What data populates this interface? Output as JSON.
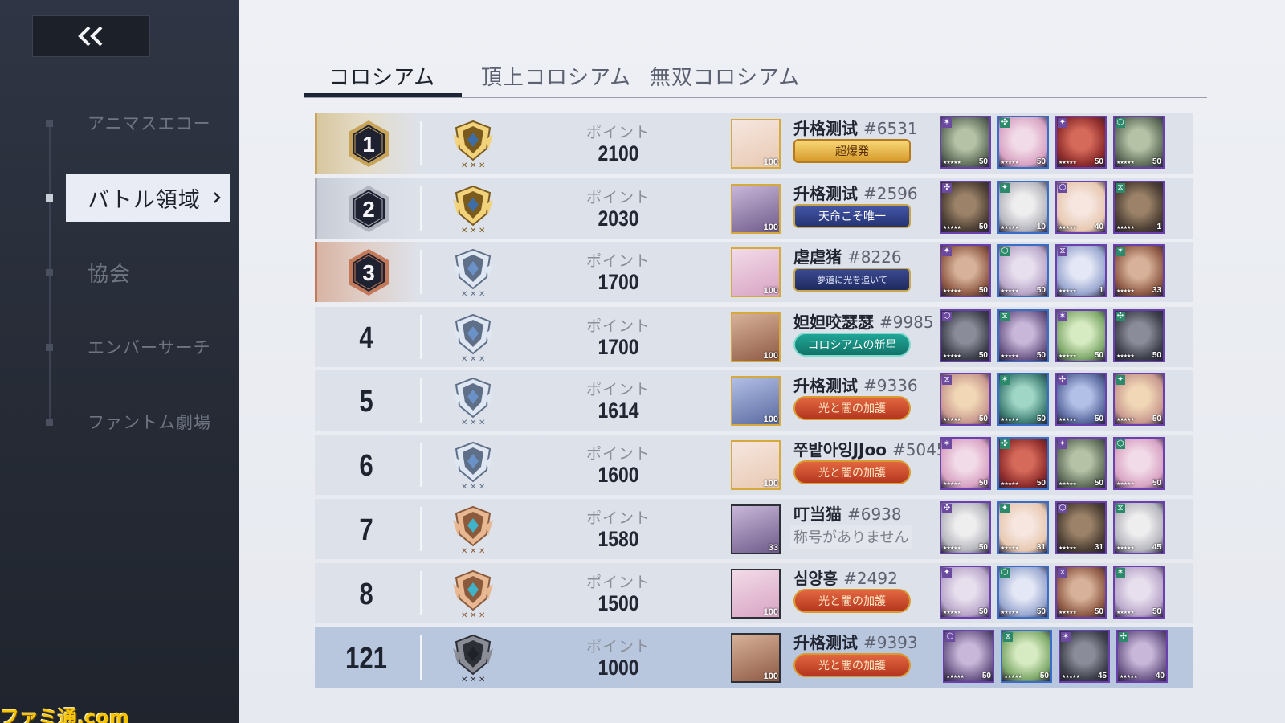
{
  "sidebar": {
    "back_icon": "double-chevron-left-icon",
    "items": [
      {
        "label": "アニマスエコー",
        "active": false
      },
      {
        "label": "バトル領域",
        "active": true
      },
      {
        "label": "協会",
        "active": false
      },
      {
        "label": "エンバーサーチ",
        "active": false
      },
      {
        "label": "ファントム劇場",
        "active": false
      }
    ],
    "watermark": "ファミ通.com"
  },
  "tabs": [
    {
      "label": "コロシアム",
      "active": true
    },
    {
      "label": "頂上コロシアム",
      "active": false
    },
    {
      "label": "無双コロシアム",
      "active": false
    }
  ],
  "ranking": {
    "points_label": "ポイント",
    "rows": [
      {
        "rank": "1",
        "tier": "gold",
        "points": "2100",
        "name": "升格测试",
        "tag": "#6531",
        "avatar_level": "100",
        "title": "超爆発",
        "title_style": "t-gold",
        "team": [
          {
            "level": "50"
          },
          {
            "level": "50"
          },
          {
            "level": "50"
          },
          {
            "level": "50"
          }
        ]
      },
      {
        "rank": "2",
        "tier": "gold",
        "points": "2030",
        "name": "升格测试",
        "tag": "#2596",
        "avatar_level": "100",
        "title": "天命こそ唯一",
        "title_style": "t-blue",
        "team": [
          {
            "level": "50"
          },
          {
            "level": "10"
          },
          {
            "level": "40"
          },
          {
            "level": "1"
          }
        ]
      },
      {
        "rank": "3",
        "tier": "silver",
        "points": "1700",
        "name": "虐虐猪",
        "tag": "#8226",
        "avatar_level": "100",
        "title": "夢道に光を追いて",
        "title_style": "t-navy",
        "team": [
          {
            "level": "50"
          },
          {
            "level": "50"
          },
          {
            "level": "1"
          },
          {
            "level": "33"
          }
        ]
      },
      {
        "rank": "4",
        "tier": "silver",
        "points": "1700",
        "name": "妲妲咬瑟瑟",
        "tag": "#9985",
        "avatar_level": "100",
        "title": "コロシアムの新星",
        "title_style": "t-teal",
        "team": [
          {
            "level": "50"
          },
          {
            "level": "50"
          },
          {
            "level": "50"
          },
          {
            "level": "50"
          }
        ]
      },
      {
        "rank": "5",
        "tier": "silver",
        "points": "1614",
        "name": "升格测试",
        "tag": "#9336",
        "avatar_level": "100",
        "title": "光と闇の加護",
        "title_style": "t-red",
        "team": [
          {
            "level": "50"
          },
          {
            "level": "50"
          },
          {
            "level": "50"
          },
          {
            "level": "50"
          }
        ]
      },
      {
        "rank": "6",
        "tier": "silver",
        "points": "1600",
        "name": "쭈밭아잉JJoo",
        "tag": "#5045",
        "avatar_level": "100",
        "title": "光と闇の加護",
        "title_style": "t-red",
        "team": [
          {
            "level": "50"
          },
          {
            "level": "50"
          },
          {
            "level": "50"
          },
          {
            "level": "50"
          }
        ]
      },
      {
        "rank": "7",
        "tier": "bronze",
        "points": "1580",
        "name": "叮当猫",
        "tag": "#6938",
        "avatar_level": "33",
        "title": "称号がありません",
        "title_style": "t-none",
        "team": [
          {
            "level": "50"
          },
          {
            "level": "31"
          },
          {
            "level": "31"
          },
          {
            "level": "45"
          }
        ]
      },
      {
        "rank": "8",
        "tier": "bronze",
        "points": "1500",
        "name": "심양홍",
        "tag": "#2492",
        "avatar_level": "100",
        "title": "光と闇の加護",
        "title_style": "t-red",
        "team": [
          {
            "level": "50"
          },
          {
            "level": "50"
          },
          {
            "level": "50"
          },
          {
            "level": "50"
          }
        ]
      },
      {
        "rank": "121",
        "tier": "iron",
        "points": "1000",
        "name": "升格测试",
        "tag": "#9393",
        "avatar_level": "100",
        "title": "光と闇の加護",
        "title_style": "t-red",
        "is_self": true,
        "team": [
          {
            "level": "50"
          },
          {
            "level": "50"
          },
          {
            "level": "45"
          },
          {
            "level": "40"
          }
        ]
      }
    ]
  },
  "colors": {
    "sidebar_bg": "#2b303c",
    "main_bg": "#e9ecf2",
    "row_bg": "#dde1e9",
    "self_row_bg": "#b9c7de",
    "gold": "#c7a45a",
    "silver": "#a8acb6",
    "bronze": "#c27a5a"
  }
}
